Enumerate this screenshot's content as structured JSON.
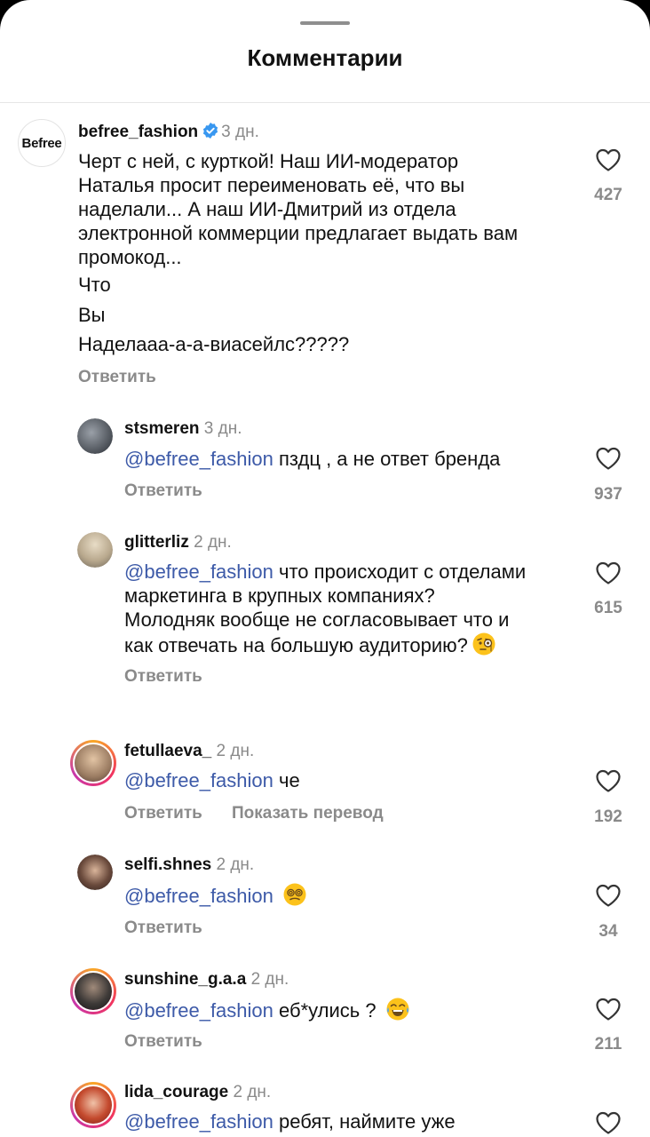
{
  "header": {
    "title": "Комментарии"
  },
  "actions": {
    "reply": "Ответить",
    "translate": "Показать перевод"
  },
  "comments": [
    {
      "avatar_text": "Befree",
      "username": "befree_fashion",
      "verified": true,
      "time": "3 дн.",
      "lines": [
        "Черт с ней, с курткой! Наш ИИ-модератор",
        "Наталья просит переименовать её, что вы",
        "наделали... А наш ИИ-Дмитрий из отдела",
        "электронной коммерции предлагает выдать вам",
        "промокод..."
      ],
      "extra_lines": [
        "Что",
        "Вы",
        "Наделааа-а-а-виасейлс?????"
      ],
      "likes": "427"
    },
    {
      "username": "stsmeren",
      "time": "3 дн.",
      "mention": "@befree_fashion",
      "text": " пздц , а не ответ бренда",
      "likes": "937"
    },
    {
      "username": "glitterliz",
      "time": "2 дн.",
      "mention": "@befree_fashion",
      "lines": [
        " что происходит с отделами",
        "маркетинга в крупных компаниях?",
        "Молодняк вообще не согласовывает что и",
        "как отвечать на большую аудиторию?"
      ],
      "emoji": "monocle-face",
      "likes": "615"
    },
    {
      "username": "fetullaeva_",
      "time": "2 дн.",
      "mention": "@befree_fashion",
      "text": " че",
      "likes": "192"
    },
    {
      "username": "selfi.shnes",
      "time": "2 дн.",
      "mention": "@befree_fashion",
      "text": " ",
      "emoji": "dizzy-face",
      "likes": "34"
    },
    {
      "username": "sunshine_g.a.a",
      "time": "2 дн.",
      "mention": "@befree_fashion",
      "text": " еб*улись ? ",
      "emoji": "tears-of-joy",
      "likes": "211"
    },
    {
      "username": "lida_courage",
      "time": "2 дн.",
      "mention": "@befree_fashion",
      "text": " ребят, наймите уже"
    }
  ],
  "colors": {
    "mention": "#3d5aa8",
    "secondary": "#8a8a8a",
    "verified": "#3897f0"
  }
}
